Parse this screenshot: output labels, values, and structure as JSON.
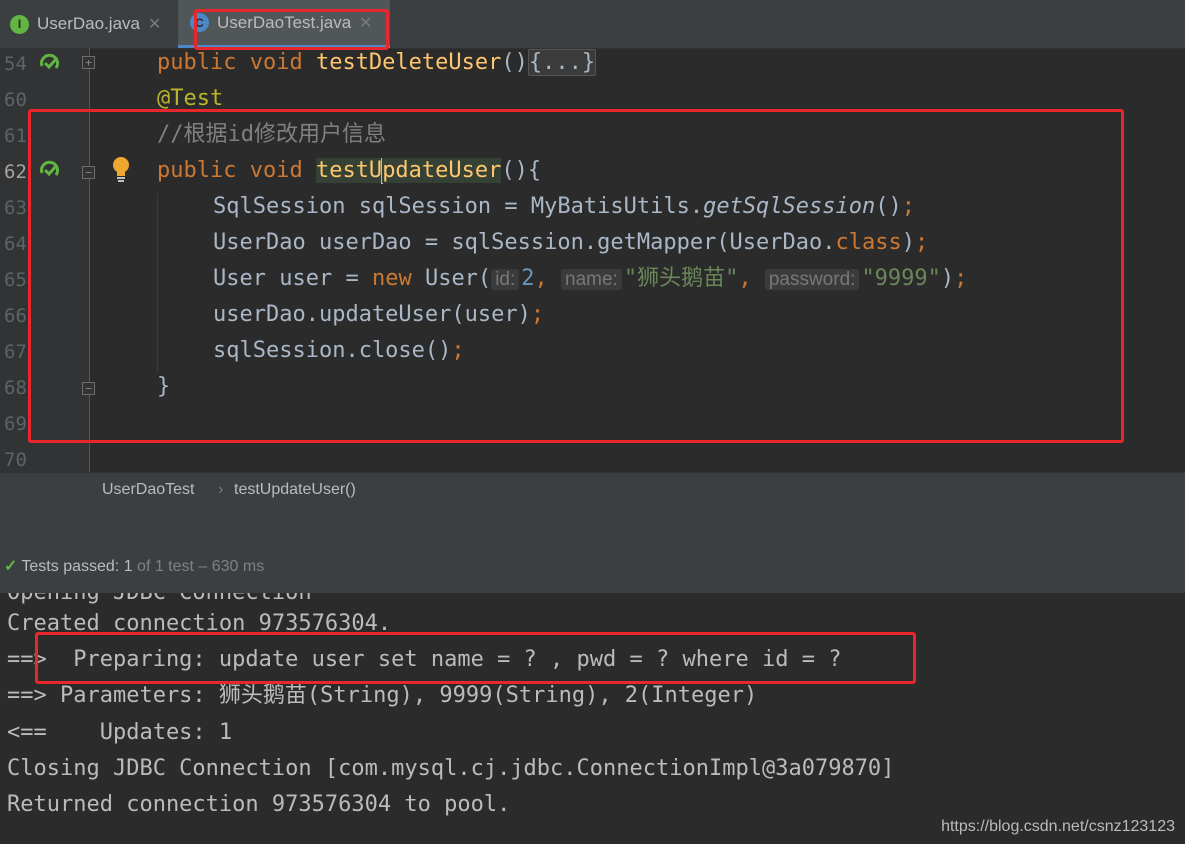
{
  "tabs": [
    {
      "label": "UserDao.java",
      "icon": "interface-icon",
      "icon_letter": "I"
    },
    {
      "label": "UserDaoTest.java",
      "icon": "test-class-icon",
      "icon_letter": "C"
    }
  ],
  "gutter": {
    "line_numbers": [
      "54",
      "60",
      "61",
      "62",
      "63",
      "64",
      "65",
      "66",
      "67",
      "68",
      "69",
      "70"
    ]
  },
  "code": {
    "l54": {
      "kw": "public void ",
      "fn": "testDeleteUser",
      "paren": "()",
      "fold": "{...}"
    },
    "l60": {
      "annotation": "@Test"
    },
    "l61": {
      "comment": "//根据id修改用户信息"
    },
    "l62": {
      "kw": "public void ",
      "fn_a": "testU",
      "fn_b": "pdateUser",
      "rest": "(){"
    },
    "l63": {
      "a": "SqlSession sqlSession = MyBatisUtils.",
      "b": "getSqlSession",
      "c": "()",
      "semi": ";"
    },
    "l64": {
      "a": "UserDao userDao = sqlSession.getMapper(UserDao.",
      "b": "class",
      "c": ")",
      "semi": ";"
    },
    "l65": {
      "a": "User user = ",
      "new": "new",
      "b": " User(",
      "hint_id": "id:",
      "v_id": "2",
      "comma": ", ",
      "hint_name": "name:",
      "v_name": "\"狮头鹅苗\"",
      "hint_pwd": "password:",
      "v_pwd": "\"9999\"",
      "c": ")",
      "semi": ";"
    },
    "l66": {
      "a": "userDao.updateUser(user)",
      "semi": ";"
    },
    "l67": {
      "a": "sqlSession.close()",
      "semi": ";"
    },
    "l68": {
      "a": "}"
    }
  },
  "breadcrumb": {
    "class": "UserDaoTest",
    "method": "testUpdateUser()",
    "sep": "›"
  },
  "status": {
    "label": "Tests passed:",
    "count": "1",
    "detail": "of 1 test – 630 ms"
  },
  "console": {
    "lines": [
      "Opening JDBC Connection",
      "Created connection 973576304.",
      "==>  Preparing: update user set name = ? , pwd = ? where id = ?",
      "==> Parameters: 狮头鹅苗(String), 9999(String), 2(Integer)",
      "<==    Updates: 1",
      "Closing JDBC Connection [com.mysql.cj.jdbc.ConnectionImpl@3a079870]",
      "Returned connection 973576304 to pool."
    ]
  },
  "watermark": "https://blog.csdn.net/csnz123123",
  "colors": {
    "highlight_box": "#e8262b",
    "keyword": "#cc7832",
    "function": "#ffc66d",
    "string": "#6a8759",
    "number": "#6897bb",
    "annotation": "#bbb529"
  }
}
